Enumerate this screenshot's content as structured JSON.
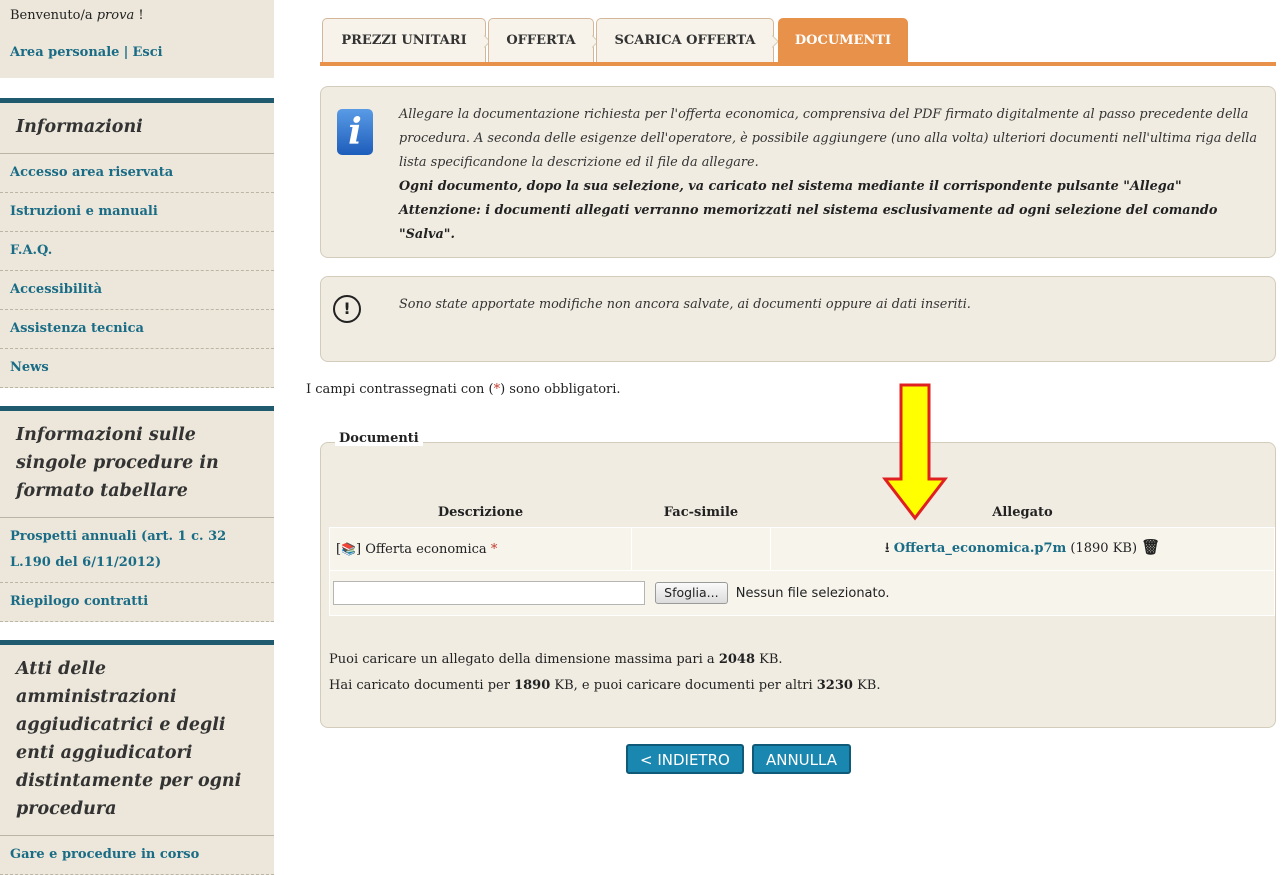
{
  "sidebar": {
    "welcome_prefix": "Benvenuto/a",
    "welcome_user": "prova",
    "welcome_suffix": "!",
    "personal_area": "Area personale",
    "separator": "|",
    "logout": "Esci",
    "sections": [
      {
        "title": "Informazioni",
        "items": [
          "Accesso area riservata",
          "Istruzioni e manuali",
          "F.A.Q.",
          "Accessibilità",
          "Assistenza tecnica",
          "News"
        ]
      },
      {
        "title": "Informazioni sulle singole procedure in formato tabellare",
        "items": [
          "Prospetti annuali (art. 1 c. 32 L.190 del 6/11/2012)",
          "Riepilogo contratti"
        ]
      },
      {
        "title": "Atti delle amministrazioni aggiudicatrici e degli enti aggiudicatori distintamente per ogni procedura",
        "items": [
          "Gare e procedure in corso"
        ]
      }
    ]
  },
  "tabs": [
    "PREZZI UNITARI",
    "OFFERTA",
    "SCARICA OFFERTA",
    "DOCUMENTI"
  ],
  "info": {
    "line1": "Allegare la documentazione richiesta per l'offerta economica, comprensiva del PDF firmato digitalmente al passo precedente della procedura. A seconda delle esigenze dell'operatore, è possibile aggiungere (uno alla volta) ulteriori documenti nell'ultima riga della lista specificandone la descrizione ed il file da allegare.",
    "line2": "Ogni documento, dopo la sua selezione, va caricato nel sistema mediante il corrispondente pulsante \"Allega\"",
    "line3": "Attenzione: i documenti allegati verranno memorizzati nel sistema esclusivamente ad ogni selezione del comando \"Salva\"."
  },
  "warning": "Sono state apportate modifiche non ancora salvate, ai documenti oppure ai dati inseriti.",
  "mandatory": {
    "prefix": "I campi contrassegnati con (",
    "star": "*",
    "suffix": ") sono obbligatori."
  },
  "documents": {
    "legend": "Documenti",
    "headers": [
      "Descrizione",
      "Fac-simile",
      "Allegato"
    ],
    "row": {
      "bracket_open": "[",
      "bracket_close": "]",
      "description": "Offerta economica",
      "required": "*",
      "file_name": "Offerta_economica.p7m",
      "file_size": "(1890 KB)"
    },
    "browse_label": "Sfoglia...",
    "no_file": "Nessun file selezionato.",
    "limit_text": "Puoi caricare un allegato della dimensione massima pari a",
    "limit_value": "2048",
    "limit_unit": "KB.",
    "used_prefix": "Hai caricato documenti per",
    "used_value": "1890",
    "used_mid": "KB, e puoi caricare documenti per altri",
    "remaining_value": "3230",
    "remaining_unit": "KB."
  },
  "buttons": {
    "back": "< INDIETRO",
    "cancel": "ANNULLA"
  },
  "colors": {
    "accent": "#e8914a",
    "link": "#1a6c86",
    "button": "#1a87b0",
    "panel": "#f0ece2",
    "arrow": "#ffff00"
  }
}
